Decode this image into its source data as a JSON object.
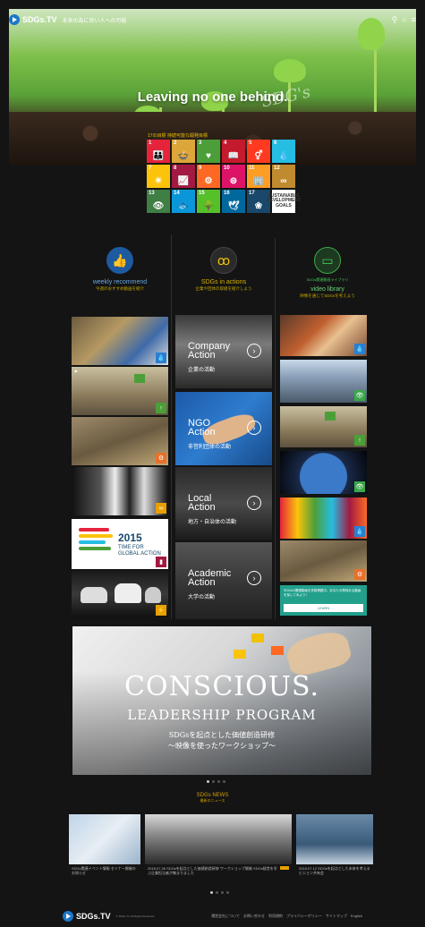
{
  "header": {
    "logo": "SDGs.TV",
    "tagline": "未来の為に良い人への可能",
    "icons": [
      "user-icon",
      "search-icon",
      "menu-icon"
    ]
  },
  "hero": {
    "title": "Leaving no one behind.",
    "script": "SDG's"
  },
  "sdgs": {
    "label": "17の目標 持続可能な開発目標",
    "goals": [
      {
        "n": "1",
        "color": "#e5243b",
        "glyph": "👪"
      },
      {
        "n": "2",
        "color": "#dda63a",
        "glyph": "🍲"
      },
      {
        "n": "3",
        "color": "#4c9f38",
        "glyph": "♥"
      },
      {
        "n": "4",
        "color": "#c5192d",
        "glyph": "📖"
      },
      {
        "n": "5",
        "color": "#ff3a21",
        "glyph": "⚥"
      },
      {
        "n": "6",
        "color": "#26bde2",
        "glyph": "💧"
      },
      {
        "n": "7",
        "color": "#fcc30b",
        "glyph": "☀"
      },
      {
        "n": "8",
        "color": "#a21942",
        "glyph": "📈"
      },
      {
        "n": "9",
        "color": "#fd6925",
        "glyph": "⚙"
      },
      {
        "n": "10",
        "color": "#dd1367",
        "glyph": "⊜"
      },
      {
        "n": "11",
        "color": "#fd9d24",
        "glyph": "🏢"
      },
      {
        "n": "12",
        "color": "#bf8b2e",
        "glyph": "∞"
      },
      {
        "n": "13",
        "color": "#3f7e44",
        "glyph": "👁"
      },
      {
        "n": "14",
        "color": "#0a97d9",
        "glyph": "🐟"
      },
      {
        "n": "15",
        "color": "#56c02b",
        "glyph": "🌳"
      },
      {
        "n": "16",
        "color": "#00689d",
        "glyph": "🕊"
      },
      {
        "n": "17",
        "color": "#19486a",
        "glyph": "❀"
      }
    ],
    "logo_tile": "SUSTAINABLE DEVELOPMENT GOALS"
  },
  "columns": {
    "weekly": {
      "title": "weekly recommend",
      "sub": "今週のおすすめ動画を紹介",
      "icon": "thumbs-up-icon"
    },
    "actions": {
      "title": "SDGs in actions",
      "sub": "企業や団体の取組を紹介しよう",
      "icon": "people-icon"
    },
    "video": {
      "pre": "SDGs関連動画ライブラリ",
      "title": "video library",
      "sub": "映像を通じてSDGsを考えよう",
      "icon": "video-camera-icon"
    }
  },
  "actions": [
    {
      "en1": "Company",
      "en2": "Action",
      "jp": "企業の活動"
    },
    {
      "en1": "NGO",
      "en2": "Action",
      "jp": "非営利団体の活動"
    },
    {
      "en1": "Local",
      "en2": "Action",
      "jp": "地方・自治体の活動"
    },
    {
      "en1": "Academic",
      "en2": "Action",
      "jp": "大学の活動"
    }
  ],
  "weekly_tiles": [
    {
      "badge_color": "#2a7fd0",
      "badge": "💧"
    },
    {
      "badge_color": "#4c9f38",
      "badge": "↑"
    },
    {
      "badge_color": "#e8702a",
      "badge": "⚙"
    },
    {
      "badge_color": "#e8a000",
      "badge": "∞"
    },
    {
      "badge_color": "#a21942",
      "badge": "▮"
    },
    {
      "badge_color": "#e8a000",
      "badge": "⚡"
    }
  ],
  "weekly_2015": {
    "year": "2015",
    "line1": "TIME FOR",
    "line2": "GLOBAL ACTION"
  },
  "video_tiles": [
    {
      "badge_color": "#2a7fd0",
      "badge": "💧"
    },
    {
      "badge_color": "#3aa84a",
      "badge": "👁"
    },
    {
      "badge_color": "#4c9f38",
      "badge": "↑"
    },
    {
      "badge_color": "#3aa84a",
      "badge": "👁"
    },
    {
      "badge_color": "#2a7fd0",
      "badge": "💧"
    },
    {
      "badge_color": "#e8702a",
      "badge": "⚙"
    }
  ],
  "video_box": {
    "text": "SDGsの関連動画を多数掲載中。あなたの興味ある動画を探してみよう！",
    "button": "LEARN"
  },
  "banner": {
    "line1": "CONSCIOUS.",
    "line2": "LEADERSHIP PROGRAM",
    "line3": "SDGsを起点とした価値創造研修",
    "line4": "〜映像を使ったワークショップ〜"
  },
  "news": {
    "title": "SDGs NEWS",
    "sub": "最新のニュース",
    "items": [
      {
        "text": "SDGs関連イベント情報 セミナー開催のお知らせ"
      },
      {
        "text": "2018.07.26 SDGsを起点とした価値創造研修 ワークショップ開催 SDGs経営を学ぶ企業担当者が集まりました"
      },
      {
        "text": "2018.07.12 SDGsを起点とした未来を考える ビジョン共有会"
      }
    ]
  },
  "footer": {
    "logo": "SDGs.TV",
    "copy": "© SDGs.TV All Rights Reserved",
    "links": [
      "運営会社について",
      "お問い合わせ",
      "利用規約",
      "プライバシーポリシー",
      "サイトマップ",
      "English"
    ]
  }
}
